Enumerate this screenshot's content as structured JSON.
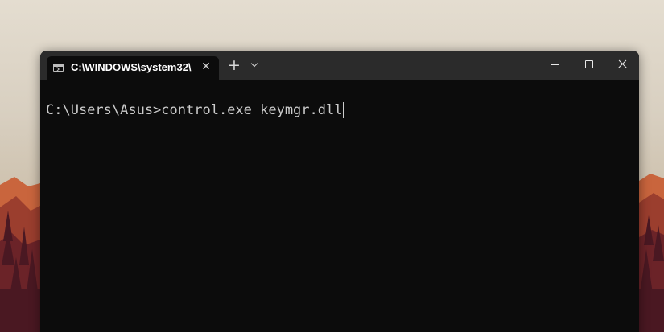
{
  "window": {
    "tab_title": "C:\\WINDOWS\\system32\\",
    "tab_icon": "terminal-icon",
    "close_tab_glyph": "✕",
    "new_tab_glyph": "+"
  },
  "console": {
    "prompt": "C:\\Users\\Asus>",
    "command": "control.exe keymgr.dll"
  },
  "colors": {
    "console_background": "#0c0c0c",
    "title_bar": "#2b2b2b",
    "text": "#cccccc"
  }
}
